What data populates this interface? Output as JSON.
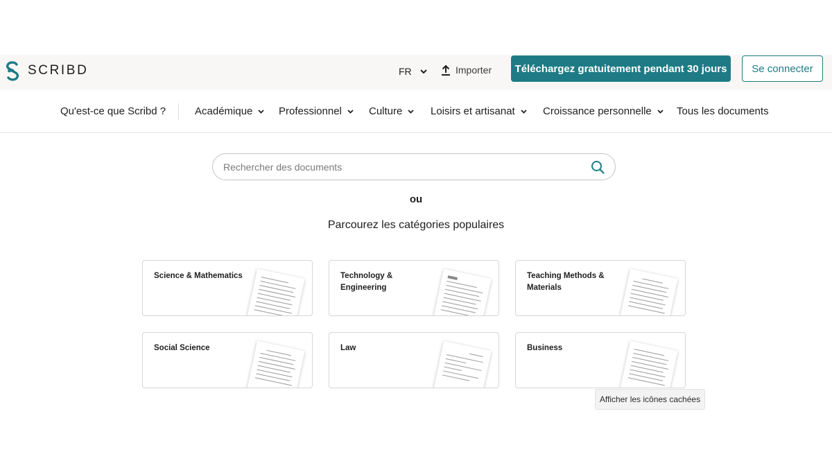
{
  "header": {
    "logo_text": "SCRIBD",
    "language": "FR",
    "upload_label": "Importer",
    "cta_label": "Téléchargez gratuitement pendant 30 jours",
    "login_label": "Se connecter"
  },
  "nav": {
    "items": [
      {
        "label": "Qu'est-ce que Scribd ?",
        "dropdown": false
      },
      {
        "label": "Académique",
        "dropdown": true
      },
      {
        "label": "Professionnel",
        "dropdown": true
      },
      {
        "label": "Culture",
        "dropdown": true
      },
      {
        "label": "Loisirs et artisanat",
        "dropdown": true
      },
      {
        "label": "Croissance personnelle",
        "dropdown": true
      },
      {
        "label": "Tous les documents",
        "dropdown": false
      }
    ]
  },
  "search": {
    "placeholder": "Rechercher des documents",
    "value": ""
  },
  "main": {
    "or_label": "ou",
    "browse_title": "Parcourez les catégories populaires",
    "categories": [
      {
        "title": "Science & Mathematics"
      },
      {
        "title": "Technology & Engineering"
      },
      {
        "title": "Teaching Methods & Materials"
      },
      {
        "title": "Social Science"
      },
      {
        "title": "Law"
      },
      {
        "title": "Business"
      }
    ]
  },
  "tooltip": {
    "text": "Afficher les icônes cachées"
  },
  "colors": {
    "accent": "#1e7b85",
    "topbar_bg": "#f8f7f5",
    "text": "#1e1e1e"
  }
}
